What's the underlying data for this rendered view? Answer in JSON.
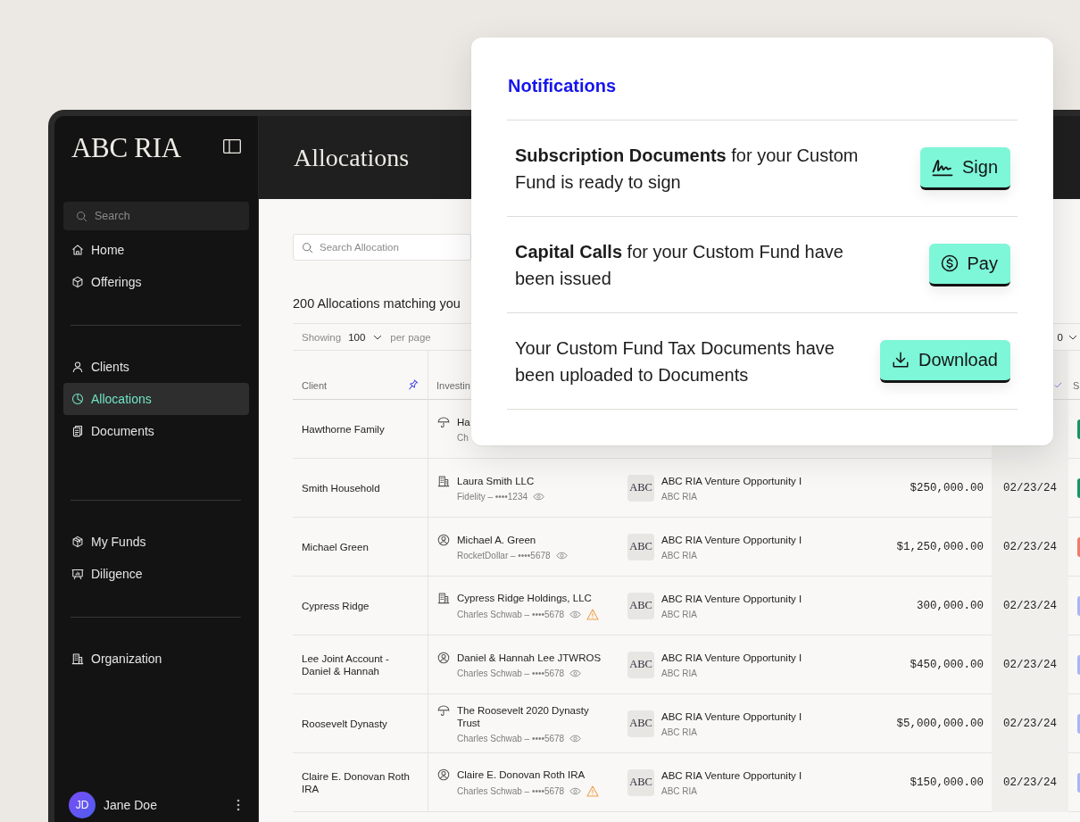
{
  "sidebar": {
    "logo": "ABC RIA",
    "search": {
      "placeholder": "Search"
    },
    "sections": [
      {
        "items": [
          {
            "label": "Home",
            "kind": "home",
            "selected": false
          },
          {
            "label": "Offerings",
            "kind": "cube",
            "selected": false
          }
        ]
      },
      {
        "items": [
          {
            "label": "Clients",
            "kind": "person",
            "selected": false
          },
          {
            "label": "Allocations",
            "kind": "pie",
            "selected": true
          },
          {
            "label": "Documents",
            "kind": "documents",
            "selected": false
          }
        ]
      },
      {
        "items": [
          {
            "label": "My Funds",
            "kind": "cubes",
            "selected": false
          },
          {
            "label": "Diligence",
            "kind": "presentation",
            "selected": false
          }
        ]
      },
      {
        "items": [
          {
            "label": "Organization",
            "kind": "building",
            "selected": false
          }
        ]
      }
    ],
    "user": {
      "initials": "JD",
      "name": "Jane Doe"
    }
  },
  "header": {
    "title": "Allocations"
  },
  "search": {
    "placeholder": "Search Allocation"
  },
  "results_summary": "200 Allocations matching you",
  "pagination": {
    "showing_label": "Showing",
    "page_size": "100",
    "per_page_label": "per page",
    "control_2": "0"
  },
  "table": {
    "columns": {
      "client": "Client",
      "column_2": "Investin",
      "column_6": "S"
    },
    "rows": [
      {
        "client": "Hawthorne Family",
        "entity": {
          "kind": "trust",
          "name": "Ha",
          "account": "Ch"
        },
        "status": {
          "color": "#15956a"
        }
      },
      {
        "client": "Smith Household",
        "entity": {
          "kind": "company",
          "name": "Laura Smith LLC",
          "account": "Fidelity – ••••1234",
          "reveal": true,
          "warning": false
        },
        "fund": {
          "logo": "ABC",
          "name": "ABC RIA Venture Opportunity I",
          "manager": "ABC RIA"
        },
        "amount": "$250,000.00",
        "date": "02/23/24",
        "status": {
          "color": "#15956a"
        }
      },
      {
        "client": "Michael Green",
        "entity": {
          "kind": "person",
          "name": "Michael A. Green",
          "account": "RocketDollar – ••••5678",
          "reveal": true,
          "warning": false
        },
        "fund": {
          "logo": "ABC",
          "name": "ABC RIA Venture Opportunity I",
          "manager": "ABC RIA"
        },
        "amount": "$1,250,000.00",
        "date": "02/23/24",
        "status": {
          "color": "#ef7b6b"
        }
      },
      {
        "client": "Cypress Ridge",
        "entity": {
          "kind": "company",
          "name": "Cypress Ridge Holdings, LLC",
          "account": "Charles Schwab – ••••5678",
          "reveal": true,
          "warning": true
        },
        "fund": {
          "logo": "ABC",
          "name": "ABC RIA Venture Opportunity I",
          "manager": "ABC RIA"
        },
        "amount": "300,000.00",
        "date": "02/23/24",
        "status": {
          "color": "#a8b6f3"
        }
      },
      {
        "client": "Lee Joint Account - Daniel & Hannah",
        "entity": {
          "kind": "person",
          "name": "Daniel & Hannah Lee JTWROS",
          "account": "Charles Schwab – ••••5678",
          "reveal": true,
          "warning": false
        },
        "fund": {
          "logo": "ABC",
          "name": "ABC RIA Venture Opportunity I",
          "manager": "ABC RIA"
        },
        "amount": "$450,000.00",
        "date": "02/23/24",
        "status": {
          "color": "#a8b6f3"
        }
      },
      {
        "client": "Roosevelt Dynasty",
        "entity": {
          "kind": "trust",
          "name": "The Roosevelt 2020 Dynasty Trust",
          "account": "Charles Schwab – ••••5678",
          "reveal": true,
          "warning": false
        },
        "fund": {
          "logo": "ABC",
          "name": "ABC RIA Venture Opportunity I",
          "manager": "ABC RIA"
        },
        "amount": "$5,000,000.00",
        "date": "02/23/24",
        "status": {
          "color": "#a8b6f3"
        }
      },
      {
        "client": "Claire E. Donovan Roth IRA",
        "entity": {
          "kind": "person",
          "name": "Claire E. Donovan Roth IRA",
          "account": "Charles Schwab – ••••5678",
          "reveal": true,
          "warning": true
        },
        "fund": {
          "logo": "ABC",
          "name": "ABC RIA Venture Opportunity I",
          "manager": "ABC RIA"
        },
        "amount": "$150,000.00",
        "date": "02/23/24",
        "status": {
          "color": "#a8b6f3"
        }
      }
    ]
  },
  "notifications": {
    "title": "Notifications",
    "items": [
      {
        "text": "**Subscription Documents** for your Custom Fund is ready to sign",
        "action": {
          "kind": "sign",
          "label": "Sign"
        }
      },
      {
        "text": "**Capital Calls** for your Custom Fund have been issued",
        "action": {
          "kind": "pay",
          "label": "Pay"
        }
      },
      {
        "text": "Your Custom Fund Tax Documents have been uploaded to Documents",
        "action": {
          "kind": "download",
          "label": "Download"
        }
      }
    ]
  }
}
